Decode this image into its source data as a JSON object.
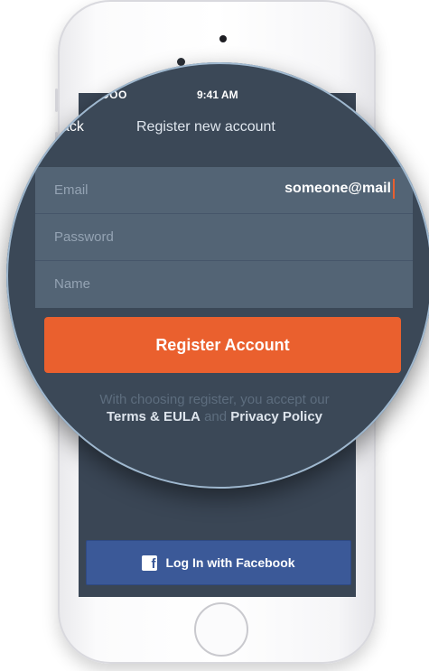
{
  "status_bar": {
    "carrier": "•••ODOO",
    "time": "9:41 AM"
  },
  "nav": {
    "back_label": "ack",
    "title": "Register new account"
  },
  "form": {
    "email_label": "Email",
    "email_value": "someone@mail",
    "password_label": "Password",
    "name_label": "Name"
  },
  "register_button": {
    "label": "Register Account"
  },
  "terms": {
    "line1": "With choosing register, you accept our",
    "terms_link": "Terms & EULA",
    "and": "and",
    "privacy_link": "Privacy Policy"
  },
  "facebook_button": {
    "label": "Log In with Facebook",
    "icon": "f"
  },
  "colors": {
    "accent": "#ea602e",
    "screen_bg": "#3b4857",
    "field_bg": "#536475",
    "facebook": "#3b5998"
  }
}
